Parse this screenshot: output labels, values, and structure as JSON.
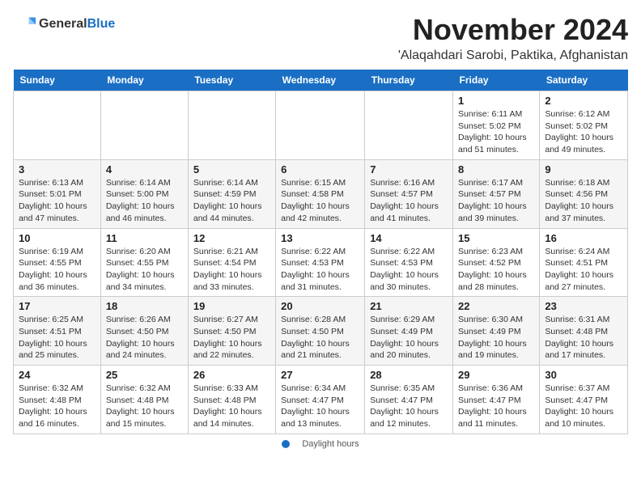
{
  "header": {
    "logo_general": "General",
    "logo_blue": "Blue",
    "month_title": "November 2024",
    "location": "'Alaqahdari Sarobi, Paktika, Afghanistan"
  },
  "weekdays": [
    "Sunday",
    "Monday",
    "Tuesday",
    "Wednesday",
    "Thursday",
    "Friday",
    "Saturday"
  ],
  "weeks": [
    [
      {
        "day": "",
        "info": ""
      },
      {
        "day": "",
        "info": ""
      },
      {
        "day": "",
        "info": ""
      },
      {
        "day": "",
        "info": ""
      },
      {
        "day": "",
        "info": ""
      },
      {
        "day": "1",
        "info": "Sunrise: 6:11 AM\nSunset: 5:02 PM\nDaylight: 10 hours\nand 51 minutes."
      },
      {
        "day": "2",
        "info": "Sunrise: 6:12 AM\nSunset: 5:02 PM\nDaylight: 10 hours\nand 49 minutes."
      }
    ],
    [
      {
        "day": "3",
        "info": "Sunrise: 6:13 AM\nSunset: 5:01 PM\nDaylight: 10 hours\nand 47 minutes."
      },
      {
        "day": "4",
        "info": "Sunrise: 6:14 AM\nSunset: 5:00 PM\nDaylight: 10 hours\nand 46 minutes."
      },
      {
        "day": "5",
        "info": "Sunrise: 6:14 AM\nSunset: 4:59 PM\nDaylight: 10 hours\nand 44 minutes."
      },
      {
        "day": "6",
        "info": "Sunrise: 6:15 AM\nSunset: 4:58 PM\nDaylight: 10 hours\nand 42 minutes."
      },
      {
        "day": "7",
        "info": "Sunrise: 6:16 AM\nSunset: 4:57 PM\nDaylight: 10 hours\nand 41 minutes."
      },
      {
        "day": "8",
        "info": "Sunrise: 6:17 AM\nSunset: 4:57 PM\nDaylight: 10 hours\nand 39 minutes."
      },
      {
        "day": "9",
        "info": "Sunrise: 6:18 AM\nSunset: 4:56 PM\nDaylight: 10 hours\nand 37 minutes."
      }
    ],
    [
      {
        "day": "10",
        "info": "Sunrise: 6:19 AM\nSunset: 4:55 PM\nDaylight: 10 hours\nand 36 minutes."
      },
      {
        "day": "11",
        "info": "Sunrise: 6:20 AM\nSunset: 4:55 PM\nDaylight: 10 hours\nand 34 minutes."
      },
      {
        "day": "12",
        "info": "Sunrise: 6:21 AM\nSunset: 4:54 PM\nDaylight: 10 hours\nand 33 minutes."
      },
      {
        "day": "13",
        "info": "Sunrise: 6:22 AM\nSunset: 4:53 PM\nDaylight: 10 hours\nand 31 minutes."
      },
      {
        "day": "14",
        "info": "Sunrise: 6:22 AM\nSunset: 4:53 PM\nDaylight: 10 hours\nand 30 minutes."
      },
      {
        "day": "15",
        "info": "Sunrise: 6:23 AM\nSunset: 4:52 PM\nDaylight: 10 hours\nand 28 minutes."
      },
      {
        "day": "16",
        "info": "Sunrise: 6:24 AM\nSunset: 4:51 PM\nDaylight: 10 hours\nand 27 minutes."
      }
    ],
    [
      {
        "day": "17",
        "info": "Sunrise: 6:25 AM\nSunset: 4:51 PM\nDaylight: 10 hours\nand 25 minutes."
      },
      {
        "day": "18",
        "info": "Sunrise: 6:26 AM\nSunset: 4:50 PM\nDaylight: 10 hours\nand 24 minutes."
      },
      {
        "day": "19",
        "info": "Sunrise: 6:27 AM\nSunset: 4:50 PM\nDaylight: 10 hours\nand 22 minutes."
      },
      {
        "day": "20",
        "info": "Sunrise: 6:28 AM\nSunset: 4:50 PM\nDaylight: 10 hours\nand 21 minutes."
      },
      {
        "day": "21",
        "info": "Sunrise: 6:29 AM\nSunset: 4:49 PM\nDaylight: 10 hours\nand 20 minutes."
      },
      {
        "day": "22",
        "info": "Sunrise: 6:30 AM\nSunset: 4:49 PM\nDaylight: 10 hours\nand 19 minutes."
      },
      {
        "day": "23",
        "info": "Sunrise: 6:31 AM\nSunset: 4:48 PM\nDaylight: 10 hours\nand 17 minutes."
      }
    ],
    [
      {
        "day": "24",
        "info": "Sunrise: 6:32 AM\nSunset: 4:48 PM\nDaylight: 10 hours\nand 16 minutes."
      },
      {
        "day": "25",
        "info": "Sunrise: 6:32 AM\nSunset: 4:48 PM\nDaylight: 10 hours\nand 15 minutes."
      },
      {
        "day": "26",
        "info": "Sunrise: 6:33 AM\nSunset: 4:48 PM\nDaylight: 10 hours\nand 14 minutes."
      },
      {
        "day": "27",
        "info": "Sunrise: 6:34 AM\nSunset: 4:47 PM\nDaylight: 10 hours\nand 13 minutes."
      },
      {
        "day": "28",
        "info": "Sunrise: 6:35 AM\nSunset: 4:47 PM\nDaylight: 10 hours\nand 12 minutes."
      },
      {
        "day": "29",
        "info": "Sunrise: 6:36 AM\nSunset: 4:47 PM\nDaylight: 10 hours\nand 11 minutes."
      },
      {
        "day": "30",
        "info": "Sunrise: 6:37 AM\nSunset: 4:47 PM\nDaylight: 10 hours\nand 10 minutes."
      }
    ]
  ],
  "footer": {
    "daylight_label": "Daylight hours"
  }
}
